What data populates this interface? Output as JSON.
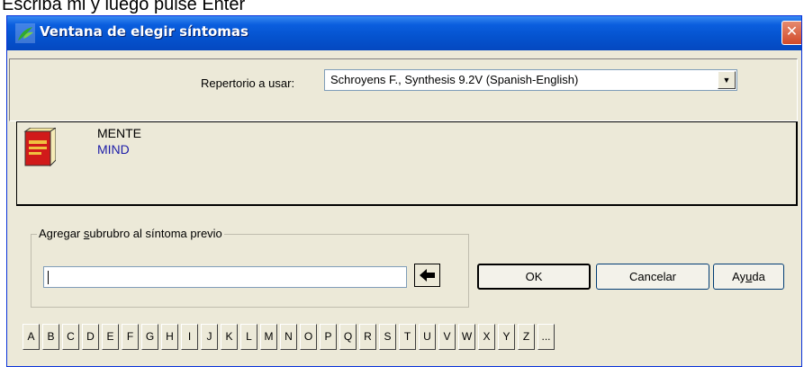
{
  "instruction": "Escriba mi y luego pulse Enter",
  "window": {
    "title": "Ventana de elegir síntomas",
    "close_label": "✕"
  },
  "repertory": {
    "label": "Repertorio a usar:",
    "selected": "Schroyens F., Synthesis 9.2V (Spanish-English)"
  },
  "rubric": {
    "spanish": "MENTE",
    "english": "MIND",
    "english_color": "#1c1ca8"
  },
  "subrubric": {
    "legend_pre": "Agregar ",
    "legend_underlined": "s",
    "legend_post": "ubrubro al síntoma previo",
    "input_value": ""
  },
  "buttons": {
    "ok": "OK",
    "cancel": "Cancelar",
    "help_pre": "Ay",
    "help_underlined": "u",
    "help_post": "da",
    "back_icon": "arrow-left-icon"
  },
  "alphabet": [
    "A",
    "B",
    "C",
    "D",
    "E",
    "F",
    "G",
    "H",
    "I",
    "J",
    "K",
    "L",
    "M",
    "N",
    "O",
    "P",
    "Q",
    "R",
    "S",
    "T",
    "U",
    "V",
    "W",
    "X",
    "Y",
    "Z",
    "..."
  ]
}
